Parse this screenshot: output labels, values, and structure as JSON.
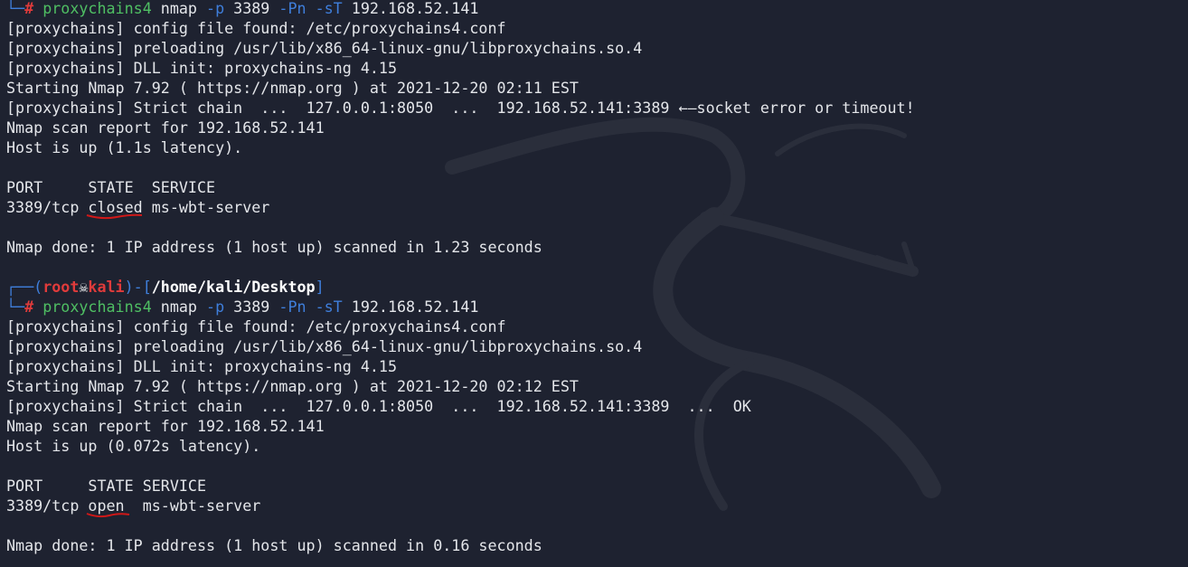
{
  "colors": {
    "background": "#1e2230",
    "text": "#e4e6ea",
    "prompt_blue": "#3f7fdc",
    "prompt_red": "#e03b3b",
    "command_green": "#4fbf63",
    "annotation_red": "#d01818"
  },
  "icons": {
    "prompt_skull": "skull-icon",
    "background": "kali-dragon-icon"
  },
  "session1": {
    "cmd": {
      "hash": "#",
      "program": "proxychains4",
      "nmap": "nmap",
      "flag_p": "-p",
      "port": "3389",
      "flag_pn": "-Pn",
      "flag_st": "-sT",
      "target": "192.168.52.141"
    },
    "output": [
      "[proxychains] config file found: /etc/proxychains4.conf",
      "[proxychains] preloading /usr/lib/x86_64-linux-gnu/libproxychains.so.4",
      "[proxychains] DLL init: proxychains-ng 4.15",
      "Starting Nmap 7.92 ( https://nmap.org ) at 2021-12-20 02:11 EST",
      "[proxychains] Strict chain  ...  127.0.0.1:8050  ...  192.168.52.141:3389 ←—socket error or timeout!",
      "Nmap scan report for 192.168.52.141",
      "Host is up (1.1s latency)."
    ],
    "header": "PORT     STATE  SERVICE",
    "row_port": "3389/tcp ",
    "row_state": "closed",
    "row_service": " ms-wbt-server",
    "done": "Nmap done: 1 IP address (1 host up) scanned in 1.23 seconds"
  },
  "prompt2": {
    "open": "┌──(",
    "user": "root",
    "host": "kali",
    "mid": ")-[",
    "path": "/home/kali/Desktop",
    "close": "]",
    "corner": "└─"
  },
  "session2": {
    "cmd": {
      "hash": "#",
      "program": "proxychains4",
      "nmap": "nmap",
      "flag_p": "-p",
      "port": "3389",
      "flag_pn": "-Pn",
      "flag_st": "-sT",
      "target": "192.168.52.141"
    },
    "output": [
      "[proxychains] config file found: /etc/proxychains4.conf",
      "[proxychains] preloading /usr/lib/x86_64-linux-gnu/libproxychains.so.4",
      "[proxychains] DLL init: proxychains-ng 4.15",
      "Starting Nmap 7.92 ( https://nmap.org ) at 2021-12-20 02:12 EST",
      "[proxychains] Strict chain  ...  127.0.0.1:8050  ...  192.168.52.141:3389  ...  OK",
      "Nmap scan report for 192.168.52.141",
      "Host is up (0.072s latency)."
    ],
    "header": "PORT     STATE SERVICE",
    "row_port": "3389/tcp ",
    "row_state": "open",
    "row_service": "  ms-wbt-server",
    "done": "Nmap done: 1 IP address (1 host up) scanned in 0.16 seconds"
  }
}
